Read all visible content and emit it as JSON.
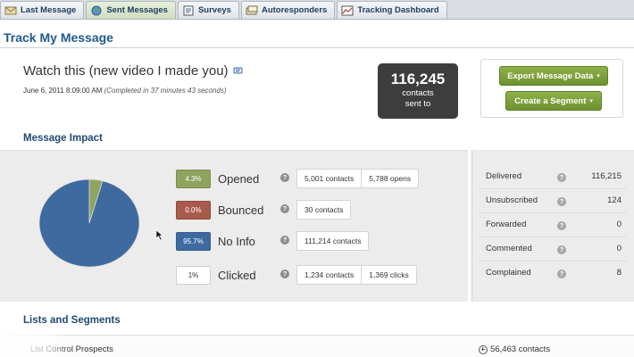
{
  "tabs": [
    {
      "label": "Last Message",
      "icon": "message-icon",
      "active": false
    },
    {
      "label": "Sent Messages",
      "icon": "globe-icon",
      "active": true
    },
    {
      "label": "Surveys",
      "icon": "survey-icon",
      "active": false
    },
    {
      "label": "Autoresponders",
      "icon": "autoresponder-icon",
      "active": false
    },
    {
      "label": "Tracking Dashboard",
      "icon": "dashboard-icon",
      "active": false
    }
  ],
  "page": {
    "title": "Track My Message"
  },
  "message": {
    "title": "Watch this (new video I made you)",
    "date": "June 6, 2011 8:09:00 AM",
    "completed": "(Completed in 37 minutes 43 seconds)"
  },
  "sent": {
    "count": "116,245",
    "label_line1": "contacts",
    "label_line2": "sent to"
  },
  "actions": {
    "export": "Export Message Data",
    "segment": "Create a Segment"
  },
  "impact": {
    "heading": "Message Impact",
    "metrics": [
      {
        "pct": "4.3%",
        "label": "Opened",
        "pills": [
          "5,001 contacts",
          "5,788 opens"
        ]
      },
      {
        "pct": "0.0%",
        "label": "Bounced",
        "pills": [
          "30 contacts"
        ]
      },
      {
        "pct": "95.7%",
        "label": "No Info",
        "pills": [
          "111,214 contacts"
        ]
      },
      {
        "pct": "1%",
        "label": "Clicked",
        "pills": [
          "1,234 contacts",
          "1,369 clicks"
        ]
      }
    ],
    "pie_shares": {
      "opened": 0.043,
      "bounced": 0.0,
      "no_info": 0.957
    }
  },
  "stats": [
    {
      "label": "Delivered",
      "value": "116,215"
    },
    {
      "label": "Unsubscribed",
      "value": "124"
    },
    {
      "label": "Forwarded",
      "value": "0"
    },
    {
      "label": "Commented",
      "value": "0"
    },
    {
      "label": "Complained",
      "value": "8"
    }
  ],
  "lists": {
    "heading": "Lists and Segments",
    "rows": [
      {
        "name": "List Control Prospects",
        "count": "56,463 contacts"
      }
    ]
  },
  "colors": {
    "opened": "#8ea35d",
    "bounced": "#a85a4c",
    "no_info": "#3e6aa0",
    "accent_green": "#7a9c3a",
    "title_blue": "#1f5a8c"
  }
}
